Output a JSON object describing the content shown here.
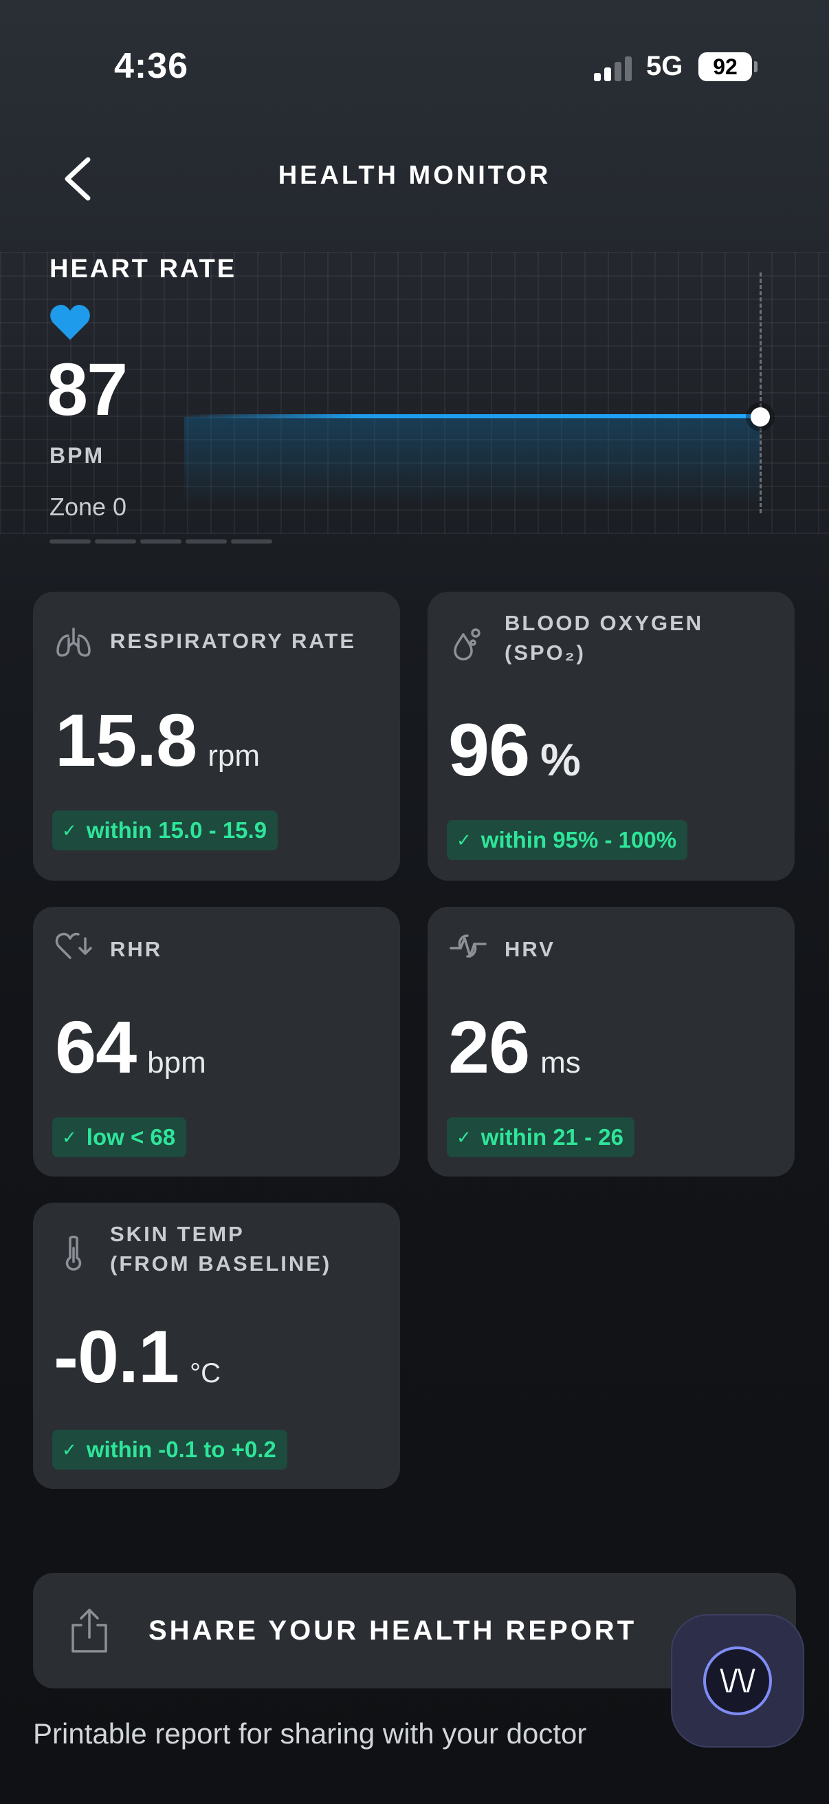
{
  "status_bar": {
    "time": "4:36",
    "network": "5G",
    "battery": "92"
  },
  "header": {
    "title": "HEALTH MONITOR",
    "back_icon": "chevron-left-icon"
  },
  "heart_rate": {
    "title": "HEART RATE",
    "value": "87",
    "unit": "BPM",
    "zone": "Zone 0",
    "icon": "heart-icon",
    "accent_color": "#1e9bea"
  },
  "metrics": {
    "respiratory": {
      "label": "RESPIRATORY RATE",
      "value": "15.8",
      "unit": "rpm",
      "badge": "within 15.0 - 15.9",
      "icon": "lungs-icon"
    },
    "spo2": {
      "label_line1": "BLOOD OXYGEN",
      "label_line2": "(SPO₂)",
      "value": "96",
      "unit": "%",
      "badge": "within 95% - 100%",
      "icon": "droplet-icon"
    },
    "rhr": {
      "label": "RHR",
      "value": "64",
      "unit": "bpm",
      "badge": "low < 68",
      "icon": "heart-down-icon"
    },
    "hrv": {
      "label": "HRV",
      "value": "26",
      "unit": "ms",
      "badge": "within 21 - 26",
      "icon": "pulse-icon"
    },
    "skin_temp": {
      "label_line1": "SKIN TEMP",
      "label_line2": "(FROM BASELINE)",
      "value": "-0.1",
      "unit": "°C",
      "badge": "within -0.1 to +0.2",
      "icon": "thermometer-icon"
    }
  },
  "badge_check": "✓",
  "badge_color": "#2ee59a",
  "share": {
    "label": "SHARE YOUR HEALTH REPORT",
    "subtitle": "Printable report for sharing with your doctor",
    "icon": "share-icon"
  },
  "assistant_button": {
    "glyph": "\\/\\/",
    "icon": "coach-icon"
  }
}
